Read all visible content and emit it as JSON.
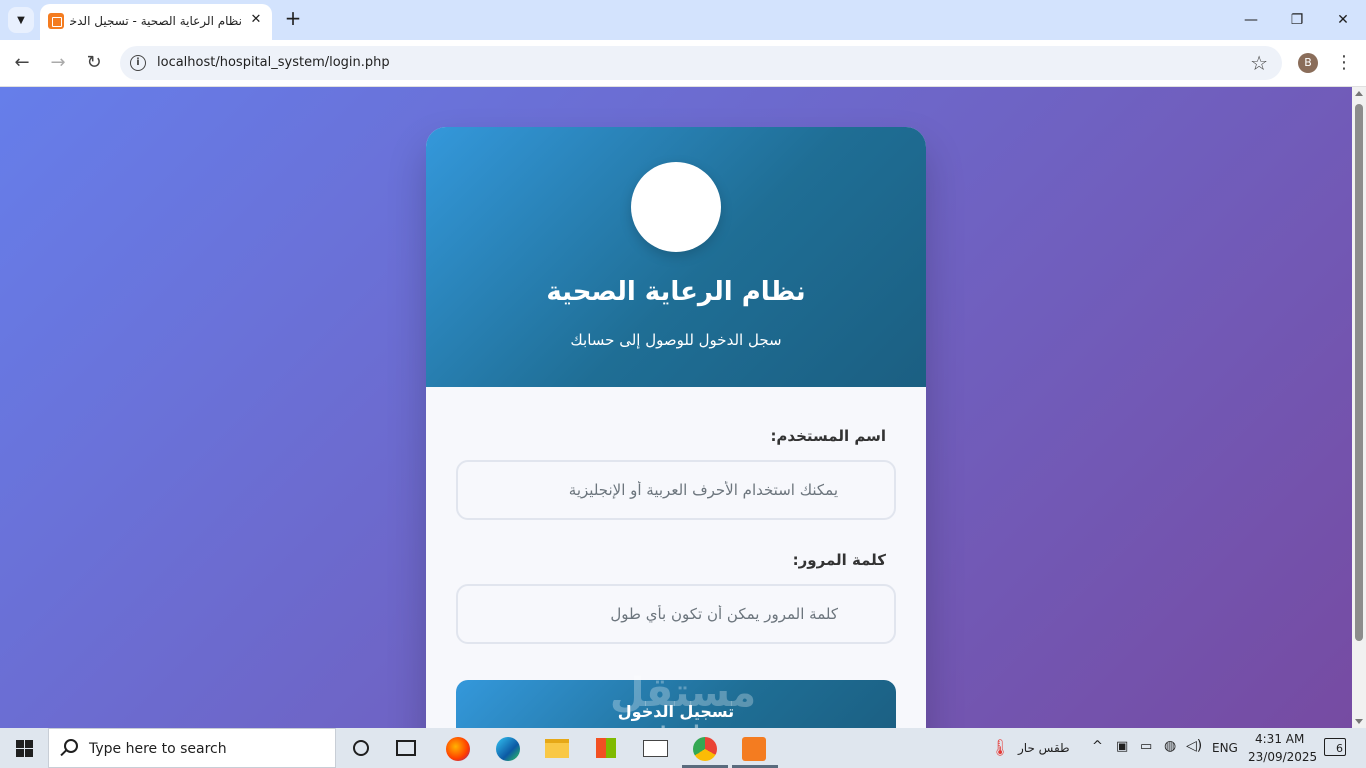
{
  "browser": {
    "tab_title": "نظام الرعاية الصحية - تسجيل الدخول",
    "url": "localhost/hospital_system/login.php",
    "profile_initial": "B",
    "icons": [
      "tab-search-icon",
      "favicon-icon",
      "close-icon",
      "plus-icon",
      "minimize-icon",
      "restore-icon",
      "window-close-icon",
      "back-icon",
      "forward-icon",
      "reload-icon",
      "info-icon",
      "star-icon",
      "more-icon"
    ]
  },
  "page": {
    "title": "نظام الرعاية الصحية",
    "subtitle": "سجل الدخول للوصول إلى حسابك",
    "username_label": "اسم المستخدم:",
    "username_placeholder": "يمكنك استخدام الأحرف العربية أو الإنجليزية",
    "password_label": "كلمة المرور:",
    "password_placeholder": "كلمة المرور يمكن أن تكون بأي طول",
    "login_button": "تسجيل الدخول",
    "background_gradient": [
      "#667eea",
      "#764ba2"
    ],
    "header_gradient": [
      "#3498db",
      "#1b5f82"
    ]
  },
  "watermark": {
    "main": "مستقل",
    "sub": "mostaql.com"
  },
  "taskbar": {
    "search_placeholder": "Type here to search",
    "weather": "طقس حار",
    "language": "ENG",
    "time": "4:31 AM",
    "date": "23/09/2025",
    "notifications_count": "6",
    "apps": [
      "cortana-icon",
      "task-view-icon",
      "firefox-icon",
      "edge-icon",
      "file-explorer-icon",
      "store-icon",
      "mail-icon",
      "chrome-icon",
      "xampp-icon"
    ]
  }
}
